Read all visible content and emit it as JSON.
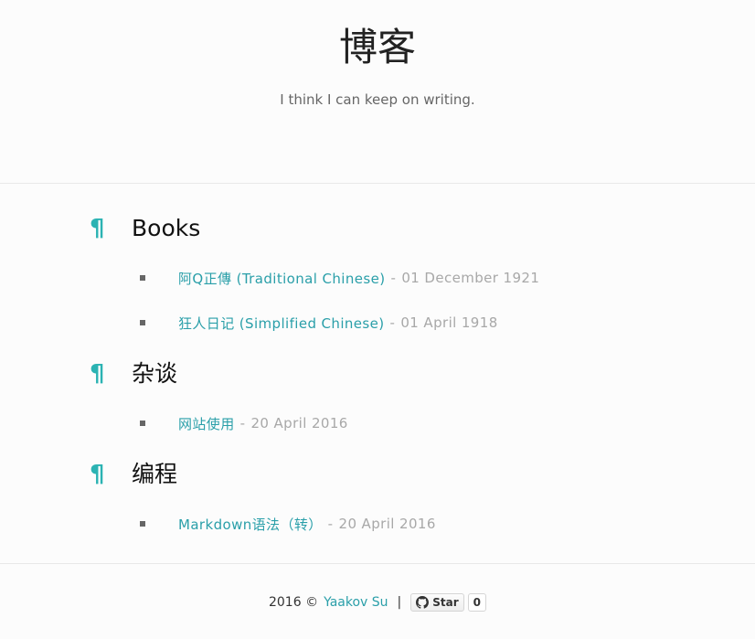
{
  "site": {
    "title": "博客",
    "subtitle": "I think I can keep on writing."
  },
  "sections": [
    {
      "pilcrow": "¶",
      "title": "Books",
      "posts": [
        {
          "title": "阿Q正傳 (Traditional Chinese)",
          "separator": "-",
          "date": "01 December 1921"
        },
        {
          "title": "狂人日记 (Simplified Chinese)",
          "separator": "-",
          "date": "01 April 1918"
        }
      ]
    },
    {
      "pilcrow": "¶",
      "title": "杂谈",
      "posts": [
        {
          "title": "网站使用",
          "separator": "-",
          "date": "20 April 2016"
        }
      ]
    },
    {
      "pilcrow": "¶",
      "title": "编程",
      "posts": [
        {
          "title": "Markdown语法（转）",
          "separator": "-",
          "date": "20 April 2016"
        }
      ]
    }
  ],
  "footer": {
    "copyright": "2016 ©",
    "author": "Yaakov Su",
    "separator": "|",
    "star_label": "Star",
    "star_count": "0",
    "star_icon": "github-icon"
  },
  "colors": {
    "accent": "#2bb3b3",
    "link": "#2a9fa9",
    "muted": "#a8a8a8",
    "background": "#fcfcfc"
  }
}
